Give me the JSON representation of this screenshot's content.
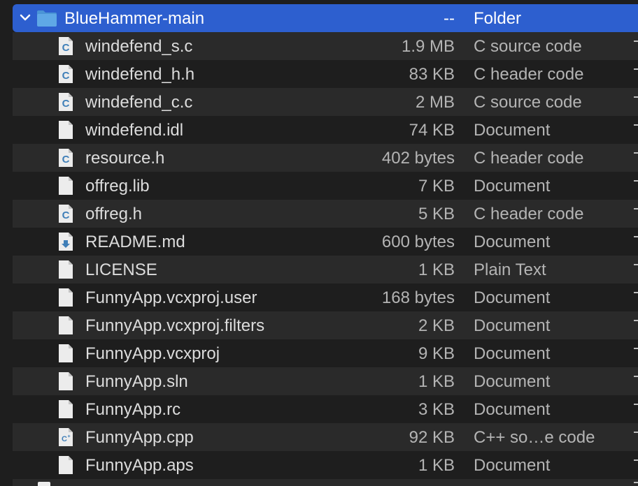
{
  "folder": {
    "name": "BlueHammer-main",
    "size": "--",
    "kind": "Folder",
    "icon": "folder-icon",
    "expanded": true
  },
  "files": [
    {
      "name": "windefend_s.c",
      "size": "1.9 MB",
      "kind": "C source code",
      "icon": "c-source-icon"
    },
    {
      "name": "windefend_h.h",
      "size": "83 KB",
      "kind": "C header code",
      "icon": "c-source-icon"
    },
    {
      "name": "windefend_c.c",
      "size": "2 MB",
      "kind": "C source code",
      "icon": "c-source-icon"
    },
    {
      "name": "windefend.idl",
      "size": "74 KB",
      "kind": "Document",
      "icon": "document-icon"
    },
    {
      "name": "resource.h",
      "size": "402 bytes",
      "kind": "C header code",
      "icon": "c-source-icon"
    },
    {
      "name": "offreg.lib",
      "size": "7 KB",
      "kind": "Document",
      "icon": "document-icon"
    },
    {
      "name": "offreg.h",
      "size": "5 KB",
      "kind": "C header code",
      "icon": "c-source-icon"
    },
    {
      "name": "README.md",
      "size": "600 bytes",
      "kind": "Document",
      "icon": "markdown-icon"
    },
    {
      "name": "LICENSE",
      "size": "1 KB",
      "kind": "Plain Text",
      "icon": "document-icon"
    },
    {
      "name": "FunnyApp.vcxproj.user",
      "size": "168 bytes",
      "kind": "Document",
      "icon": "document-icon"
    },
    {
      "name": "FunnyApp.vcxproj.filters",
      "size": "2 KB",
      "kind": "Document",
      "icon": "document-icon"
    },
    {
      "name": "FunnyApp.vcxproj",
      "size": "9 KB",
      "kind": "Document",
      "icon": "document-icon"
    },
    {
      "name": "FunnyApp.sln",
      "size": "1 KB",
      "kind": "Document",
      "icon": "document-icon"
    },
    {
      "name": "FunnyApp.rc",
      "size": "3 KB",
      "kind": "Document",
      "icon": "document-icon"
    },
    {
      "name": "FunnyApp.cpp",
      "size": "92 KB",
      "kind": "C++ so…e code",
      "icon": "cpp-source-icon"
    },
    {
      "name": "FunnyApp.aps",
      "size": "1 KB",
      "kind": "Document",
      "icon": "document-icon"
    }
  ],
  "colors": {
    "selection": "#2d5fcf",
    "background": "#1e1e1e",
    "stripe": "#2a2a2a",
    "folder_blue": "#5fa8e6",
    "c_letter": "#3f7fb8",
    "cpp_letter": "#3f7fb8"
  }
}
